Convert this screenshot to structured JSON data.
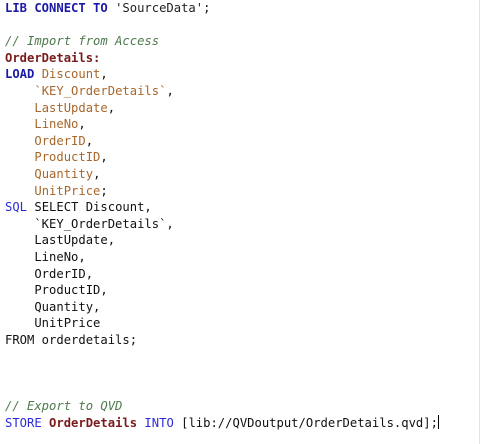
{
  "editor": {
    "lines": [
      {
        "parts": [
          {
            "t": "LIB CONNECT TO ",
            "c": "kwb"
          },
          {
            "t": "'SourceData'",
            "c": "str"
          },
          {
            "t": ";",
            "c": "pl"
          }
        ]
      },
      {
        "parts": []
      },
      {
        "parts": [
          {
            "t": "// Import from Access",
            "c": "cmt"
          }
        ]
      },
      {
        "parts": [
          {
            "t": "OrderDetails:",
            "c": "lbl"
          }
        ]
      },
      {
        "parts": [
          {
            "t": "LOAD ",
            "c": "kwb"
          },
          {
            "t": "Discount",
            "c": "fld"
          },
          {
            "t": ",",
            "c": "pl"
          }
        ]
      },
      {
        "parts": [
          {
            "t": "    ",
            "c": "pl"
          },
          {
            "t": "`KEY_OrderDetails`",
            "c": "fld"
          },
          {
            "t": ",",
            "c": "pl"
          }
        ]
      },
      {
        "parts": [
          {
            "t": "    ",
            "c": "pl"
          },
          {
            "t": "LastUpdate",
            "c": "fld"
          },
          {
            "t": ",",
            "c": "pl"
          }
        ]
      },
      {
        "parts": [
          {
            "t": "    ",
            "c": "pl"
          },
          {
            "t": "LineNo",
            "c": "fld"
          },
          {
            "t": ",",
            "c": "pl"
          }
        ]
      },
      {
        "parts": [
          {
            "t": "    ",
            "c": "pl"
          },
          {
            "t": "OrderID",
            "c": "fld"
          },
          {
            "t": ",",
            "c": "pl"
          }
        ]
      },
      {
        "parts": [
          {
            "t": "    ",
            "c": "pl"
          },
          {
            "t": "ProductID",
            "c": "fld"
          },
          {
            "t": ",",
            "c": "pl"
          }
        ]
      },
      {
        "parts": [
          {
            "t": "    ",
            "c": "pl"
          },
          {
            "t": "Quantity",
            "c": "fld"
          },
          {
            "t": ",",
            "c": "pl"
          }
        ]
      },
      {
        "parts": [
          {
            "t": "    ",
            "c": "pl"
          },
          {
            "t": "UnitPrice",
            "c": "fld"
          },
          {
            "t": ";",
            "c": "pl"
          }
        ]
      },
      {
        "parts": [
          {
            "t": "SQL ",
            "c": "kw"
          },
          {
            "t": "SELECT Discount,",
            "c": "pl"
          }
        ]
      },
      {
        "parts": [
          {
            "t": "    `KEY_OrderDetails`,",
            "c": "pl"
          }
        ]
      },
      {
        "parts": [
          {
            "t": "    LastUpdate,",
            "c": "pl"
          }
        ]
      },
      {
        "parts": [
          {
            "t": "    LineNo,",
            "c": "pl"
          }
        ]
      },
      {
        "parts": [
          {
            "t": "    OrderID,",
            "c": "pl"
          }
        ]
      },
      {
        "parts": [
          {
            "t": "    ProductID,",
            "c": "pl"
          }
        ]
      },
      {
        "parts": [
          {
            "t": "    Quantity,",
            "c": "pl"
          }
        ]
      },
      {
        "parts": [
          {
            "t": "    UnitPrice",
            "c": "pl"
          }
        ]
      },
      {
        "parts": [
          {
            "t": "FROM orderdetails;",
            "c": "pl"
          }
        ]
      },
      {
        "parts": []
      },
      {
        "parts": []
      },
      {
        "parts": []
      },
      {
        "parts": [
          {
            "t": "// Export to QVD",
            "c": "cmt"
          }
        ]
      },
      {
        "parts": [
          {
            "t": "STORE ",
            "c": "kw"
          },
          {
            "t": "OrderDetails",
            "c": "lbl"
          },
          {
            "t": " INTO ",
            "c": "kw"
          },
          {
            "t": "[lib://QVDoutput/OrderDetails.qvd];",
            "c": "pl"
          }
        ],
        "cursor": true
      }
    ]
  }
}
